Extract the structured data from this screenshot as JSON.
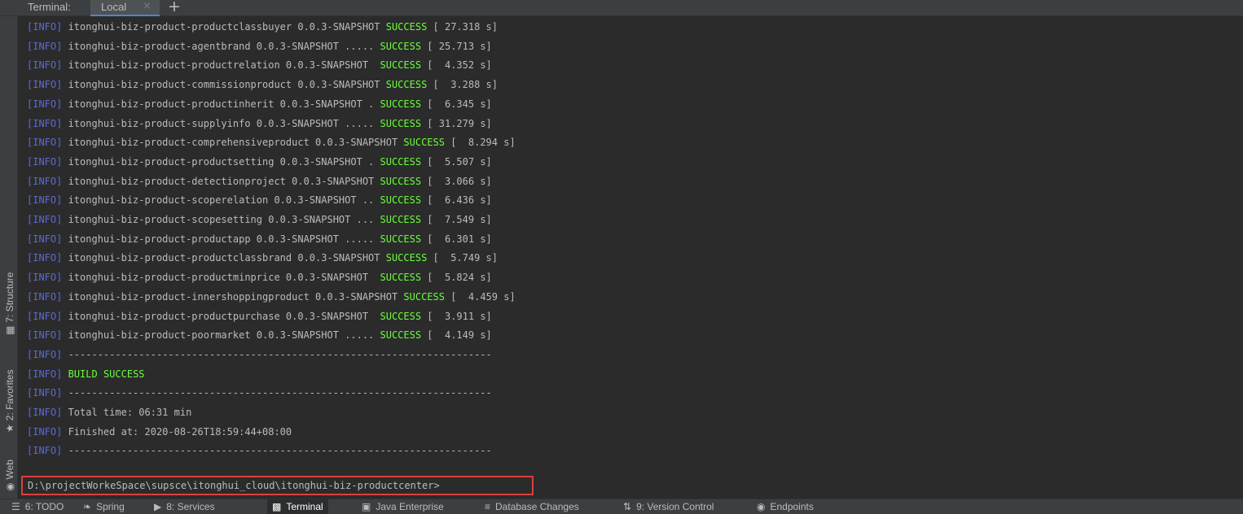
{
  "tabbar": {
    "title": "Terminal:",
    "tab_label": "Local",
    "close_glyph": "×",
    "add_glyph": "+"
  },
  "left_tools": [
    {
      "label": "7: Structure",
      "icon": "structure-icon"
    },
    {
      "label": "2: Favorites",
      "icon": "star-icon"
    },
    {
      "label": "Web",
      "icon": "web-icon"
    }
  ],
  "terminal": {
    "lines": [
      {
        "tag": "[INFO]",
        "text": " itonghui-biz-product-productclassbuyer 0.0.3-SNAPSHOT ",
        "status": "SUCCESS",
        "tail": " [ 27.318 s]"
      },
      {
        "tag": "[INFO]",
        "text": " itonghui-biz-product-agentbrand 0.0.3-SNAPSHOT ..... ",
        "status": "SUCCESS",
        "tail": " [ 25.713 s]"
      },
      {
        "tag": "[INFO]",
        "text": " itonghui-biz-product-productrelation 0.0.3-SNAPSHOT  ",
        "status": "SUCCESS",
        "tail": " [  4.352 s]"
      },
      {
        "tag": "[INFO]",
        "text": " itonghui-biz-product-commissionproduct 0.0.3-SNAPSHOT ",
        "status": "SUCCESS",
        "tail": " [  3.288 s]"
      },
      {
        "tag": "[INFO]",
        "text": " itonghui-biz-product-productinherit 0.0.3-SNAPSHOT . ",
        "status": "SUCCESS",
        "tail": " [  6.345 s]"
      },
      {
        "tag": "[INFO]",
        "text": " itonghui-biz-product-supplyinfo 0.0.3-SNAPSHOT ..... ",
        "status": "SUCCESS",
        "tail": " [ 31.279 s]"
      },
      {
        "tag": "[INFO]",
        "text": " itonghui-biz-product-comprehensiveproduct 0.0.3-SNAPSHOT ",
        "status": "SUCCESS",
        "tail": " [  8.294 s]"
      },
      {
        "tag": "[INFO]",
        "text": " itonghui-biz-product-productsetting 0.0.3-SNAPSHOT . ",
        "status": "SUCCESS",
        "tail": " [  5.507 s]"
      },
      {
        "tag": "[INFO]",
        "text": " itonghui-biz-product-detectionproject 0.0.3-SNAPSHOT ",
        "status": "SUCCESS",
        "tail": " [  3.066 s]"
      },
      {
        "tag": "[INFO]",
        "text": " itonghui-biz-product-scoperelation 0.0.3-SNAPSHOT .. ",
        "status": "SUCCESS",
        "tail": " [  6.436 s]"
      },
      {
        "tag": "[INFO]",
        "text": " itonghui-biz-product-scopesetting 0.0.3-SNAPSHOT ... ",
        "status": "SUCCESS",
        "tail": " [  7.549 s]"
      },
      {
        "tag": "[INFO]",
        "text": " itonghui-biz-product-productapp 0.0.3-SNAPSHOT ..... ",
        "status": "SUCCESS",
        "tail": " [  6.301 s]"
      },
      {
        "tag": "[INFO]",
        "text": " itonghui-biz-product-productclassbrand 0.0.3-SNAPSHOT ",
        "status": "SUCCESS",
        "tail": " [  5.749 s]"
      },
      {
        "tag": "[INFO]",
        "text": " itonghui-biz-product-productminprice 0.0.3-SNAPSHOT  ",
        "status": "SUCCESS",
        "tail": " [  5.824 s]"
      },
      {
        "tag": "[INFO]",
        "text": " itonghui-biz-product-innershoppingproduct 0.0.3-SNAPSHOT ",
        "status": "SUCCESS",
        "tail": " [  4.459 s]"
      },
      {
        "tag": "[INFO]",
        "text": " itonghui-biz-product-productpurchase 0.0.3-SNAPSHOT  ",
        "status": "SUCCESS",
        "tail": " [  3.911 s]"
      },
      {
        "tag": "[INFO]",
        "text": " itonghui-biz-product-poormarket 0.0.3-SNAPSHOT ..... ",
        "status": "SUCCESS",
        "tail": " [  4.149 s]"
      },
      {
        "tag": "[INFO]",
        "text": " ------------------------------------------------------------------------",
        "status": "",
        "tail": ""
      },
      {
        "tag": "[INFO]",
        "text": " ",
        "status": "BUILD SUCCESS",
        "tail": ""
      },
      {
        "tag": "[INFO]",
        "text": " ------------------------------------------------------------------------",
        "status": "",
        "tail": ""
      },
      {
        "tag": "[INFO]",
        "text": " Total time: 06:31 min",
        "status": "",
        "tail": ""
      },
      {
        "tag": "[INFO]",
        "text": " Finished at: 2020-08-26T18:59:44+08:00",
        "status": "",
        "tail": ""
      },
      {
        "tag": "[INFO]",
        "text": " ------------------------------------------------------------------------",
        "status": "",
        "tail": ""
      }
    ],
    "prompt": "D:\\projectWorkeSpace\\supsce\\itonghui_cloud\\itonghui-biz-productcenter>"
  },
  "bottom_tools": [
    {
      "label": "6: TODO",
      "icon": "todo-list-icon",
      "active": false
    },
    {
      "label": "Spring",
      "icon": "spring-leaf-icon",
      "active": false
    },
    {
      "label": "8: Services",
      "icon": "services-icon",
      "active": false
    },
    {
      "label": "Terminal",
      "icon": "terminal-icon",
      "active": true
    },
    {
      "label": "Java Enterprise",
      "icon": "java-enterprise-icon",
      "active": false
    },
    {
      "label": "Database Changes",
      "icon": "database-icon",
      "active": false
    },
    {
      "label": "9: Version Control",
      "icon": "version-control-icon",
      "active": false
    },
    {
      "label": "Endpoints",
      "icon": "endpoints-icon",
      "active": false
    }
  ],
  "colors": {
    "background": "#2b2b2b",
    "info_tag": "#5a6ad6",
    "success": "#6aff3b",
    "text": "#bbbbbb",
    "prompt_highlight": "#d9413c"
  }
}
